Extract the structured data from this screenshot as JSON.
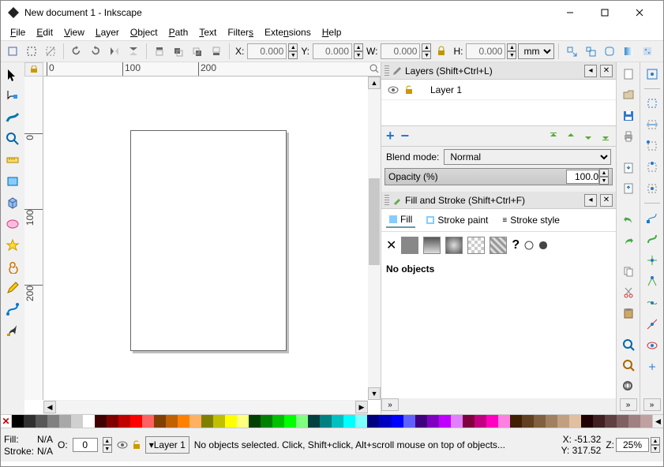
{
  "title": "New document 1 - Inkscape",
  "menus": [
    "File",
    "Edit",
    "View",
    "Layer",
    "Object",
    "Path",
    "Text",
    "Filters",
    "Extensions",
    "Help"
  ],
  "toolbar": {
    "x_label": "X:",
    "y_label": "Y:",
    "w_label": "W:",
    "h_label": "H:",
    "x": "0.000",
    "y": "0.000",
    "w": "0.000",
    "h": "0.000",
    "unit": "mm"
  },
  "ruler_h": [
    0,
    100,
    200
  ],
  "ruler_v": [
    0,
    100,
    200
  ],
  "panels": {
    "layers": {
      "title": "Layers (Shift+Ctrl+L)",
      "items": [
        {
          "name": "Layer 1"
        }
      ],
      "blend_label": "Blend mode:",
      "blend_value": "Normal",
      "opacity_label": "Opacity (%)",
      "opacity_value": "100.0"
    },
    "fillstroke": {
      "title": "Fill and Stroke (Shift+Ctrl+F)",
      "tabs": [
        "Fill",
        "Stroke paint",
        "Stroke style"
      ],
      "empty_msg": "No objects"
    }
  },
  "palette": [
    "#000000",
    "#303030",
    "#585858",
    "#808080",
    "#a8a8a8",
    "#d0d0d0",
    "#ffffff",
    "#400000",
    "#800000",
    "#c00000",
    "#ff0000",
    "#ff6060",
    "#804000",
    "#c06000",
    "#ff8000",
    "#ffb060",
    "#808000",
    "#c0c000",
    "#ffff00",
    "#ffff80",
    "#004000",
    "#008000",
    "#00c000",
    "#00ff00",
    "#80ff80",
    "#004040",
    "#008080",
    "#00c0c0",
    "#00ffff",
    "#80ffff",
    "#000080",
    "#0000c0",
    "#0000ff",
    "#6060ff",
    "#400080",
    "#8000c0",
    "#c000ff",
    "#e080ff",
    "#800040",
    "#c00080",
    "#ff00c0",
    "#ff80e0",
    "#402000",
    "#604020",
    "#806040",
    "#a08060",
    "#c0a080",
    "#e0c0a0",
    "#200000",
    "#402020",
    "#604040",
    "#806060",
    "#a08080",
    "#c0a0a0"
  ],
  "status": {
    "fill_label": "Fill:",
    "stroke_label": "Stroke:",
    "fill": "N/A",
    "stroke": "N/A",
    "o_label": "O:",
    "o_value": "0",
    "layer_label": "Layer 1",
    "message": "No objects selected. Click, Shift+click, Alt+scroll mouse on top of objects...",
    "x_label": "X:",
    "y_label": "Y:",
    "x": "-51.32",
    "y": "317.52",
    "z_label": "Z:",
    "zoom": "25%"
  }
}
